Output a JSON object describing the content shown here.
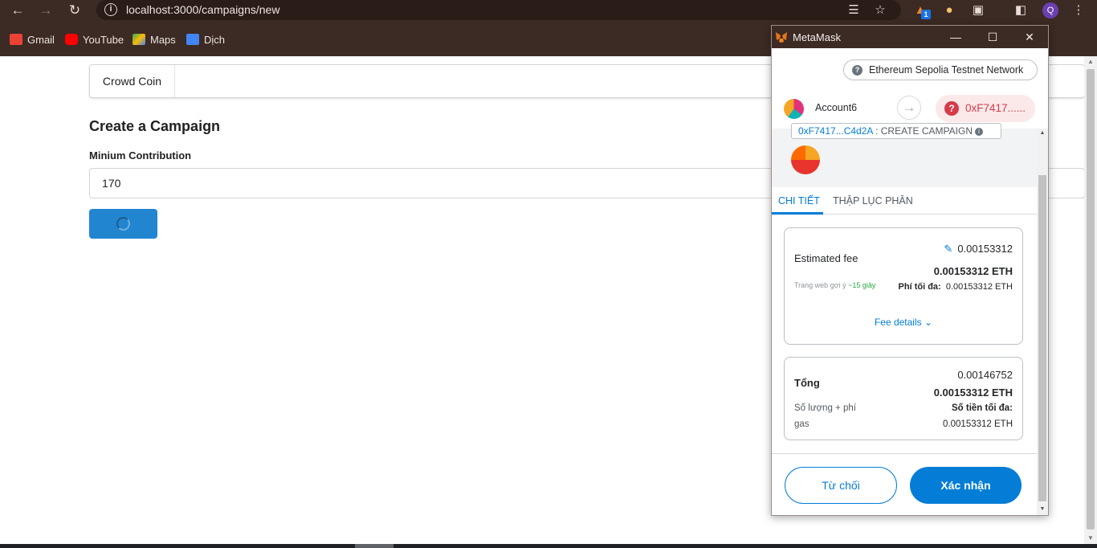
{
  "browser": {
    "url": "localhost:3000/campaigns/new",
    "bookmarks": [
      "Gmail",
      "YouTube",
      "Maps",
      "Dịch"
    ],
    "extension_badge": "1",
    "profile_initial": "Q"
  },
  "app": {
    "menu_brand": "Crowd Coin",
    "page_title": "Create a Campaign",
    "field_label": "Minium Contribution",
    "field_value": "170"
  },
  "metamask": {
    "window_title": "MetaMask",
    "network": "Ethereum Sepolia Testnet Network",
    "account_name": "Account6",
    "to_address": "0xF7417......",
    "origin_address": "0xF7417...C4d2A",
    "origin_separator": " : ",
    "origin_action": "CREATE CAMPAIGN",
    "tabs": [
      "CHI TIẾT",
      "THẬP LỤC PHÂN"
    ],
    "fee": {
      "label": "Estimated fee",
      "value_top": "0.00153312",
      "value_eth": "0.00153312 ETH",
      "site_suggested": "Trang web gợi ý",
      "time": "~15 giây",
      "max_fee_label": "Phí tối đa:",
      "max_fee_value": "0.00153312 ETH",
      "details_link": "Fee details"
    },
    "total": {
      "label": "Tổng",
      "value_top": "0.00146752",
      "value_eth": "0.00153312 ETH",
      "sub_label_1": "Số lượng + phí",
      "sub_label_2": "gas",
      "max_amount_label": "Số tiền tối đa:",
      "max_amount_value": "0.00153312 ETH"
    },
    "buttons": {
      "reject": "Từ chối",
      "confirm": "Xác nhận"
    }
  },
  "colors": {
    "accent": "#037dd6",
    "semantic_primary": "#2185d0",
    "chrome_frame": "#3c2a24",
    "error": "#d73a49"
  }
}
